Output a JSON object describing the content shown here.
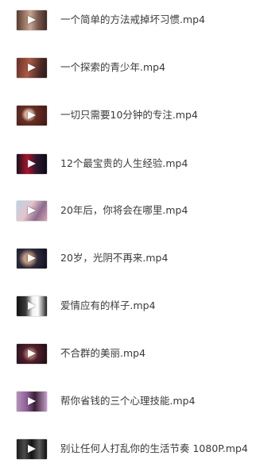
{
  "files": [
    {
      "name": "一个简单的方法戒掉坏习惯.mp4",
      "icon": "video-thumbnail-icon"
    },
    {
      "name": "一个探索的青少年.mp4",
      "icon": "video-thumbnail-icon"
    },
    {
      "name": "一切只需要10分钟的专注.mp4",
      "icon": "video-thumbnail-icon"
    },
    {
      "name": "12个最宝贵的人生经验.mp4",
      "icon": "video-thumbnail-icon"
    },
    {
      "name": "20年后，你将会在哪里.mp4",
      "icon": "video-thumbnail-icon"
    },
    {
      "name": "20岁，光阴不再来.mp4",
      "icon": "video-thumbnail-icon"
    },
    {
      "name": "爱情应有的样子.mp4",
      "icon": "video-thumbnail-icon"
    },
    {
      "name": "不合群的美丽.mp4",
      "icon": "video-thumbnail-icon"
    },
    {
      "name": "帮你省钱的三个心理技能.mp4",
      "icon": "video-thumbnail-icon"
    },
    {
      "name": "别让任何人打乱你的生活节奏 1080P.mp4",
      "icon": "video-thumbnail-icon"
    }
  ]
}
